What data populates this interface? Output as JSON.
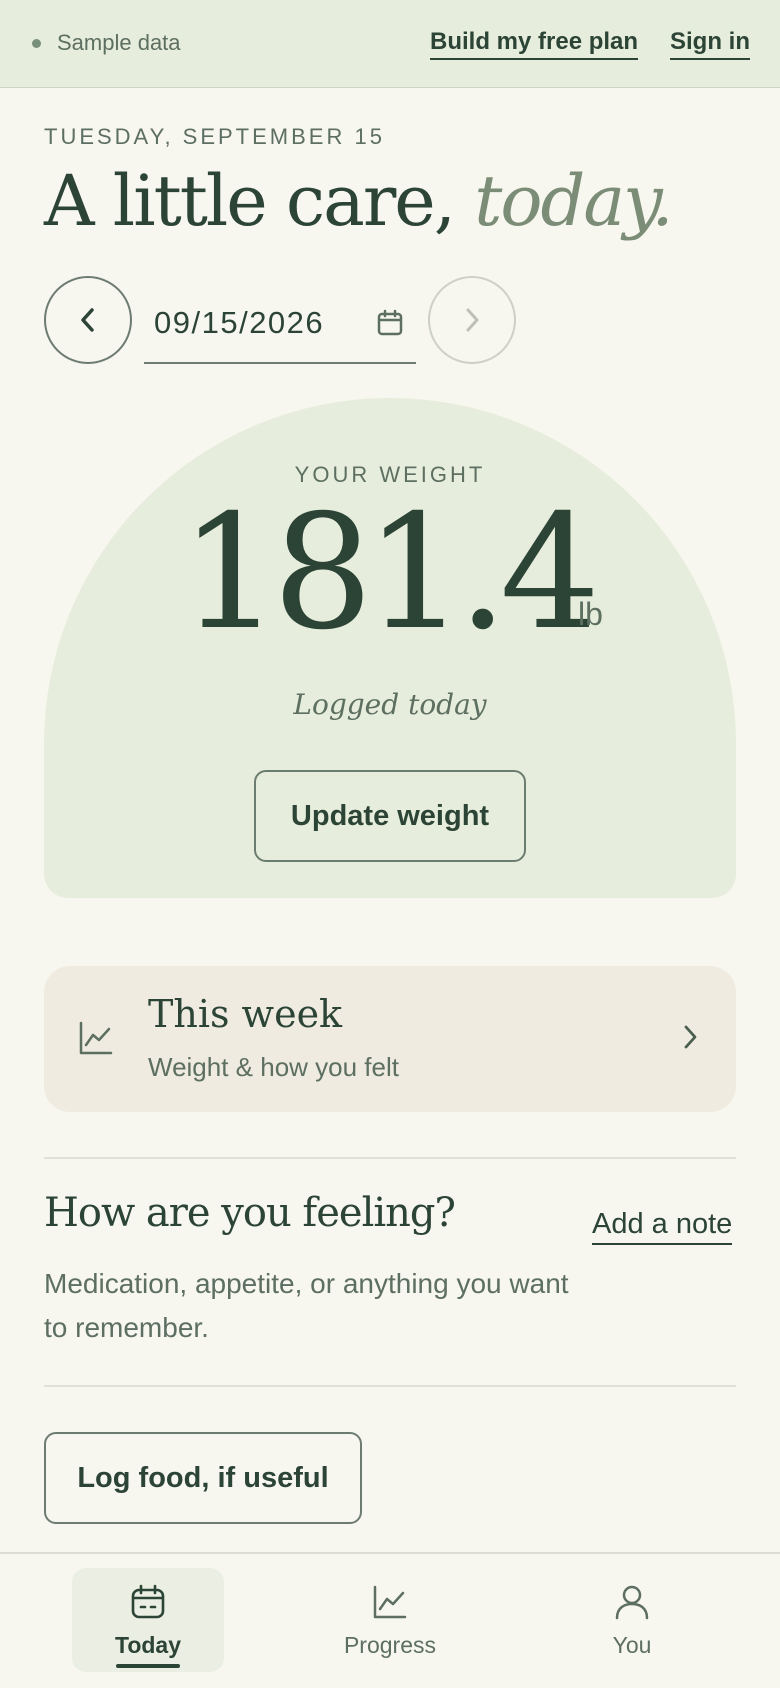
{
  "topbar": {
    "status_text": "Sample data",
    "build_plan_link": "Build my free plan",
    "sign_in_link": "Sign in"
  },
  "header": {
    "date_label": "TUESDAY, SEPTEMBER 15",
    "headline_main": "A little care,",
    "headline_accent": "today."
  },
  "date_picker": {
    "value": "09/15/2026",
    "prev_icon": "chevron-left-icon",
    "next_icon": "chevron-right-icon",
    "calendar_icon": "calendar-icon"
  },
  "weight_card": {
    "label": "YOUR WEIGHT",
    "value": "181.4",
    "unit": "lb",
    "status": "Logged today",
    "update_button": "Update weight"
  },
  "week_card": {
    "title": "This week",
    "subtitle": "Weight & how you felt",
    "icon": "line-chart-icon"
  },
  "feeling": {
    "title": "How are you feeling?",
    "add_note": "Add a note",
    "description": "Medication, appetite, or anything you want to remember."
  },
  "log_food_button": "Log food, if useful",
  "bottom_nav": {
    "tabs": [
      {
        "label": "Today",
        "icon": "calendar-face-icon",
        "active": true
      },
      {
        "label": "Progress",
        "icon": "line-chart-icon",
        "active": false
      },
      {
        "label": "You",
        "icon": "person-icon",
        "active": false
      }
    ]
  },
  "colors": {
    "background": "#f7f6ef",
    "topbar_bg": "#e7eddc",
    "primary_text": "#2c4436",
    "secondary_text": "#5d6f61",
    "accent": "#7b8d76",
    "week_card_bg": "#efebe1"
  }
}
